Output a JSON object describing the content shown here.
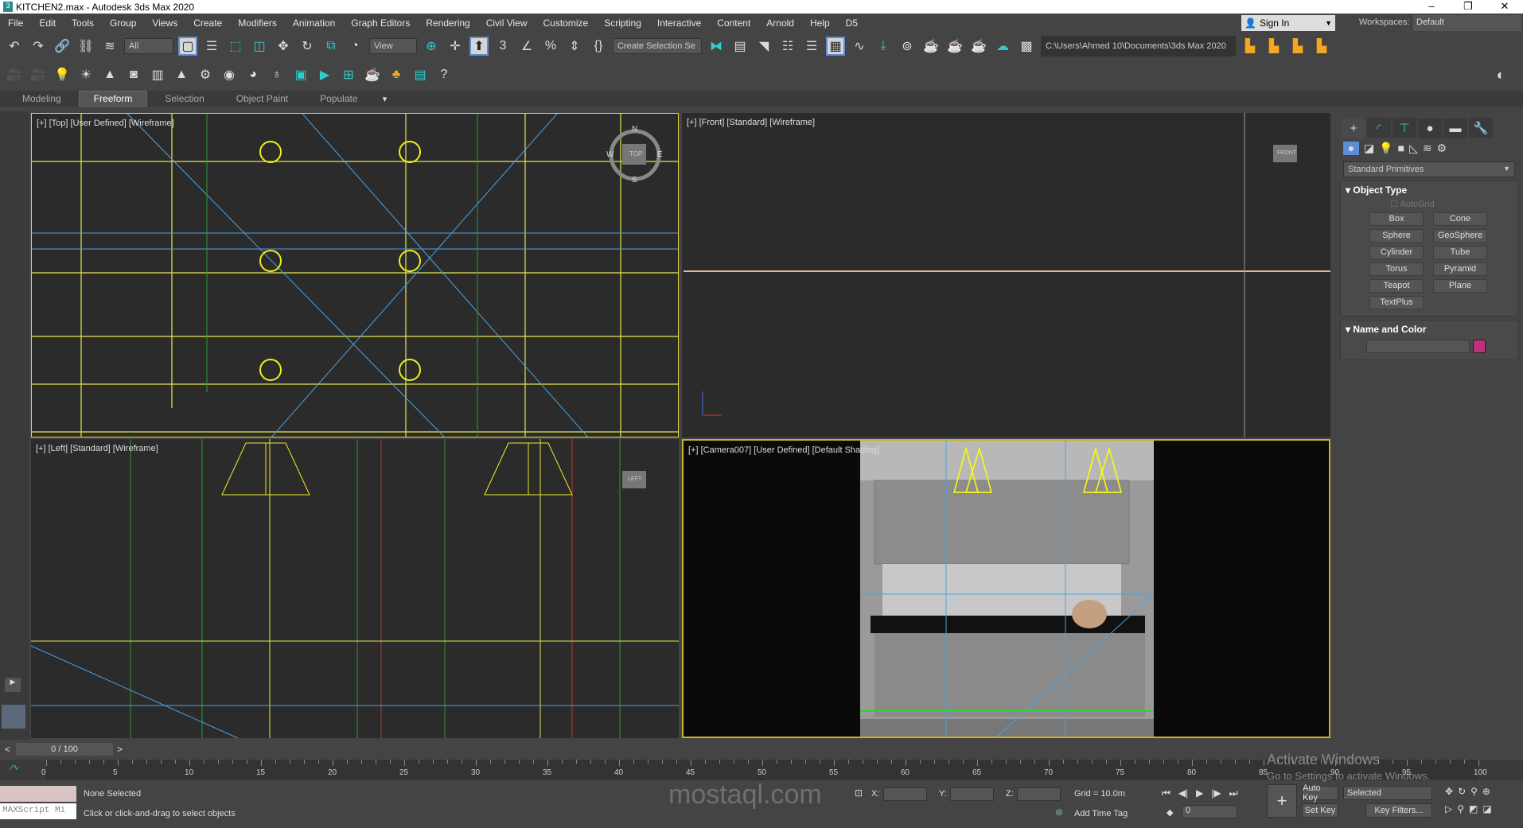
{
  "window": {
    "title": "KITCHEN2.max - Autodesk 3ds Max 2020",
    "app_icon": "3",
    "controls": [
      "–",
      "❐",
      "✕"
    ]
  },
  "menu": [
    "File",
    "Edit",
    "Tools",
    "Group",
    "Views",
    "Create",
    "Modifiers",
    "Animation",
    "Graph Editors",
    "Rendering",
    "Civil View",
    "Customize",
    "Scripting",
    "Interactive",
    "Content",
    "Arnold",
    "Help",
    "D5"
  ],
  "account": {
    "sign_in": "Sign In",
    "workspaces_label": "Workspaces:",
    "workspace": "Default"
  },
  "toolbar": {
    "filter": "All",
    "ref_coord": "View",
    "selection_set": "Create Selection Se",
    "project_path": "C:\\Users\\Ahmed 10\\Documents\\3ds Max 2020"
  },
  "ribbon": {
    "tabs": [
      "Modeling",
      "Freeform",
      "Selection",
      "Object Paint",
      "Populate"
    ],
    "active": "Freeform"
  },
  "viewports": {
    "top": "[+] [Top] [User Defined] [Wireframe]",
    "front": "[+] [Front] [Standard] [Wireframe]",
    "left": "[+] [Left] [Standard] [Wireframe]",
    "camera": "[+] [Camera007] [User Defined] [Default Shading]",
    "viewcube_top": "TOP",
    "viewcube_front": "FRONT",
    "viewcube_left": "LEFT",
    "compass": [
      "N",
      "E",
      "S",
      "W"
    ]
  },
  "command_panel": {
    "category": "Standard Primitives",
    "object_type_title": "Object Type",
    "autogrid": "AutoGrid",
    "buttons": [
      "Box",
      "Cone",
      "Sphere",
      "GeoSphere",
      "Cylinder",
      "Tube",
      "Torus",
      "Pyramid",
      "Teapot",
      "Plane",
      "TextPlus"
    ],
    "name_color_title": "Name and Color",
    "object_color": "#c0307c"
  },
  "timeline": {
    "frame": "0 / 100",
    "ticks": [
      "0",
      "5",
      "10",
      "15",
      "20",
      "25",
      "30",
      "35",
      "40",
      "45",
      "50",
      "55",
      "60",
      "65",
      "70",
      "75",
      "80",
      "85",
      "90",
      "95",
      "100"
    ]
  },
  "status": {
    "selection": "None Selected",
    "prompt": "Click or click-and-drag to select objects",
    "maxscript": "MAXScript Mi",
    "x_label": "X:",
    "y_label": "Y:",
    "z_label": "Z:",
    "grid": "Grid = 10.0m",
    "add_time_tag": "Add Time Tag",
    "auto_key": "Auto Key",
    "set_key": "Set Key",
    "key_mode": "Selected",
    "key_filters": "Key Filters...",
    "current_frame": "0"
  },
  "watermark": {
    "activate_title": "Activate Windows",
    "activate_sub": "Go to Settings to activate Windows.",
    "logo": "mostaql.com"
  }
}
